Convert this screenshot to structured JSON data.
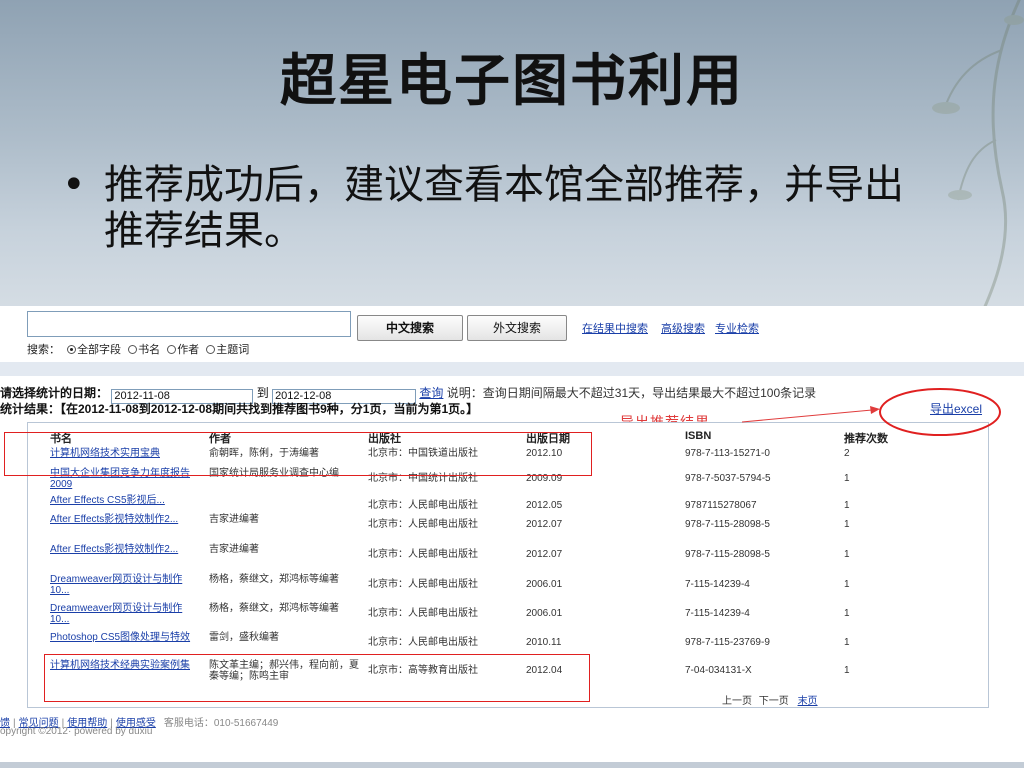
{
  "slide": {
    "title": "超星电子图书利用",
    "bullet": "推荐成功后，建议查看本馆全部推荐，并导出推荐结果。"
  },
  "search": {
    "value": "",
    "cn_button": "中文搜索",
    "foreign_button": "外文搜索",
    "links": [
      "在结果中搜索",
      "高级搜索",
      "专业检索"
    ],
    "scope_label": "搜索：",
    "scope_options": [
      "全部字段",
      "书名",
      "作者",
      "主题词"
    ],
    "scope_selected": "全部字段"
  },
  "stats": {
    "date_label": "请选择统计的日期：",
    "start_date": "2012-11-08",
    "to_label": "到",
    "end_date": "2012-12-08",
    "query_link": "查询",
    "note": "说明：查询日期间隔最大不超过31天，导出结果最大不超过100条记录",
    "result_text": "统计结果：【在2012-11-08到2012-12-08期间共找到推荐图书9种，分1页，当前为第1页。】",
    "export_link": "导出excel",
    "annotation": "导出推荐结果"
  },
  "table": {
    "headers": [
      "书名",
      "作者",
      "出版社",
      "出版日期",
      "ISBN",
      "推荐次数"
    ],
    "rows": [
      {
        "title": "计算机网络技术实用宝典",
        "author": "俞朝晖，陈俐，于涛编著",
        "publisher": "北京市：中国铁道出版社",
        "date": "2012.10",
        "isbn": "978-7-113-15271-0",
        "count": "2"
      },
      {
        "title": "中国大企业集团竞争力年度报告 2009",
        "author": "国家统计局服务业调查中心编",
        "publisher": "北京市：中国统计出版社",
        "date": "2009.09",
        "isbn": "978-7-5037-5794-5",
        "count": "1"
      },
      {
        "title": "After Effects CS5影视后...",
        "author": "",
        "publisher": "北京市：人民邮电出版社",
        "date": "2012.05",
        "isbn": "9787115278067",
        "count": "1"
      },
      {
        "title": "After Effects影视特效制作2...",
        "author": "吉家进编著",
        "publisher": "北京市：人民邮电出版社",
        "date": "2012.07",
        "isbn": "978-7-115-28098-5",
        "count": "1"
      },
      {
        "title": "After Effects影视特效制作2...",
        "author": "吉家进编著",
        "publisher": "北京市：人民邮电出版社",
        "date": "2012.07",
        "isbn": "978-7-115-28098-5",
        "count": "1"
      },
      {
        "title": "Dreamweaver网页设计与制作10...",
        "author": "杨格，蔡继文，郑鸿标等编著",
        "publisher": "北京市：人民邮电出版社",
        "date": "2006.01",
        "isbn": "7-115-14239-4",
        "count": "1"
      },
      {
        "title": "Dreamweaver网页设计与制作10...",
        "author": "杨格，蔡继文，郑鸿标等编著",
        "publisher": "北京市：人民邮电出版社",
        "date": "2006.01",
        "isbn": "7-115-14239-4",
        "count": "1"
      },
      {
        "title": "Photoshop CS5图像处理与特效",
        "author": "雷剑，盛秋编著",
        "publisher": "北京市：人民邮电出版社",
        "date": "2010.11",
        "isbn": "978-7-115-23769-9",
        "count": "1"
      },
      {
        "title": "计算机网络技术经典实验案例集",
        "author": "陈文革主编；郝兴伟，程向前，夏秦等编；陈鸣主审",
        "publisher": "北京市：高等教育出版社",
        "date": "2012.04",
        "isbn": "7-04-034131-X",
        "count": "1"
      }
    ],
    "pager": {
      "prev": "上一页",
      "next": "下一页",
      "last": "末页"
    }
  },
  "footer": {
    "links": [
      "馈",
      "常见问题",
      "使用帮助",
      "使用感受"
    ],
    "service": "客服电话：010-51667449",
    "copyright": "opyright ©2012· powered by duxiu"
  },
  "colors": {
    "link": "#1a3fa8",
    "annotation": "#e03c3c"
  }
}
